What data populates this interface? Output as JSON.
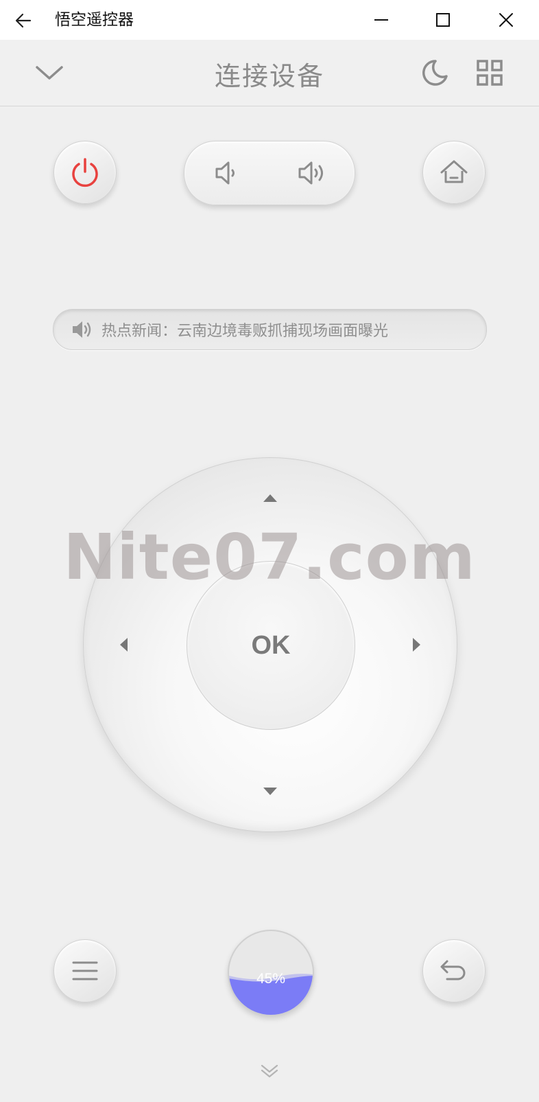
{
  "window": {
    "title": "悟空遥控器",
    "back_icon": "arrow-left-icon",
    "minimize_icon": "minimize-icon",
    "maximize_icon": "maximize-icon",
    "close_icon": "close-icon"
  },
  "header": {
    "title": "连接设备",
    "dropdown_icon": "chevron-down-icon",
    "night_icon": "moon-icon",
    "apps_icon": "grid-icon"
  },
  "controls": {
    "power_icon": "power-icon",
    "power_color": "#e8423f",
    "volume_down_icon": "volume-down-icon",
    "volume_up_icon": "volume-up-icon",
    "home_icon": "home-icon",
    "menu_icon": "menu-icon",
    "back_icon": "return-icon",
    "more_icon": "double-chevron-down-icon"
  },
  "news": {
    "icon": "speaker-icon",
    "text": "热点新闻：云南边境毒贩抓捕现场画面曝光"
  },
  "dpad": {
    "ok_label": "OK",
    "up_icon": "triangle-up-icon",
    "down_icon": "triangle-down-icon",
    "left_icon": "triangle-left-icon",
    "right_icon": "triangle-right-icon"
  },
  "watermark": {
    "text": "Nite07.com"
  },
  "progress": {
    "value": 0.45,
    "label": "45%",
    "fill_color": "#7b7cf6"
  }
}
